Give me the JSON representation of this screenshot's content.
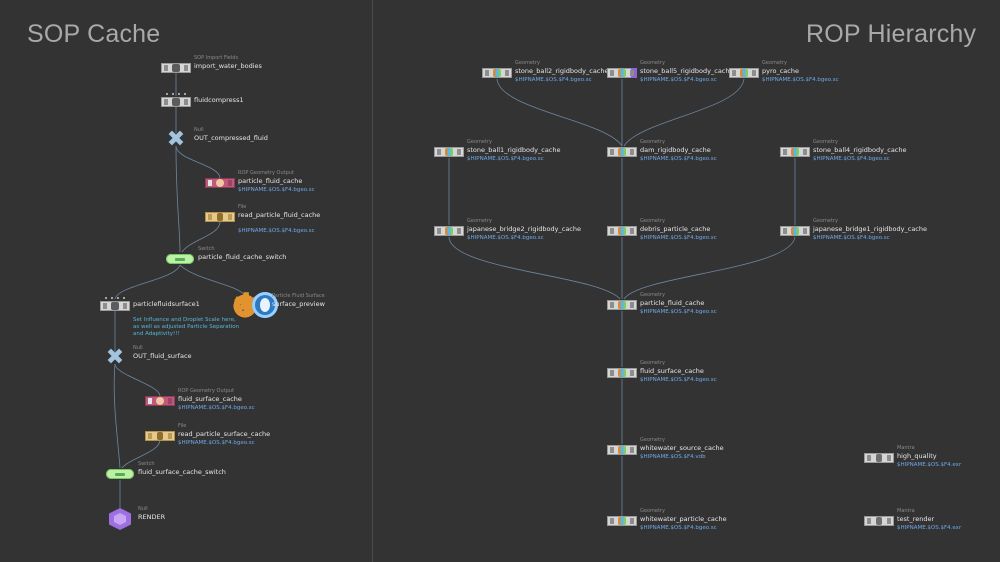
{
  "panels": {
    "left": {
      "title": "SOP Cache"
    },
    "right": {
      "title": "ROP Hierarchy"
    }
  },
  "sop_nodes": {
    "import_water_bodies": {
      "type": "SOP Import Fields",
      "name": "import_water_bodies",
      "icon": "sop-import-fields-icon"
    },
    "fluidcompress1": {
      "type": "",
      "name": "fluidcompress1",
      "icon": "fluid-compress-icon"
    },
    "out_compressed_fluid": {
      "type": "Null",
      "name": "OUT_compressed_fluid",
      "icon": "null-x-icon"
    },
    "particle_fluid_cache": {
      "type": "ROP Geometry Output",
      "name": "particle_fluid_cache",
      "path": "$HIPNAME.$OS.$F4.bgeo.sc",
      "icon": "rop-geometry-output-icon"
    },
    "read_particle_fluid_cache": {
      "type": "File",
      "name": "read_particle_fluid_cache",
      "path": "$HIPNAME.$OS.$F4.bgeo.sc",
      "icon": "file-icon"
    },
    "particle_fluid_cache_switch": {
      "type": "Switch",
      "name": "particle_fluid_cache_switch",
      "icon": "switch-icon"
    },
    "particlefluidsurface1": {
      "type": "",
      "name": "particlefluidsurface1",
      "comment": "Set Influence and Droplet Scale here, as well as adjusted Particle Separation and Adaptivity!!!",
      "icon": "particle-fluid-surface-icon"
    },
    "surface_preview": {
      "type": "Particle Fluid Surface",
      "name": "surface_preview",
      "icon": "particle-fluid-surface-gear-icon"
    },
    "out_fluid_surface": {
      "type": "Null",
      "name": "OUT_fluid_surface",
      "icon": "null-x-icon"
    },
    "fluid_surface_cache": {
      "type": "ROP Geometry Output",
      "name": "fluid_surface_cache",
      "path": "$HIPNAME.$OS.$F4.bgeo.sc",
      "icon": "rop-geometry-output-icon"
    },
    "read_particle_surface_cache": {
      "type": "File",
      "name": "read_particle_surface_cache",
      "path": "$HIPNAME.$OS.$F4.bgeo.sc",
      "icon": "file-icon"
    },
    "fluid_surface_cache_switch": {
      "type": "Switch",
      "name": "fluid_surface_cache_switch",
      "icon": "switch-icon"
    },
    "render": {
      "type": "Null",
      "name": "RENDER",
      "icon": "render-cube-icon"
    }
  },
  "rop_nodes": {
    "stone_ball2": {
      "type": "Geometry",
      "name": "stone_ball2_rigidbody_cache",
      "path": "$HIPNAME.$OS.$F4.bgeo.sc"
    },
    "stone_ball5": {
      "type": "Geometry",
      "name": "stone_ball5_rigidbody_cache",
      "path": "$HIPNAME.$OS.$F4.bgeo.sc"
    },
    "pyro_cache": {
      "type": "Geometry",
      "name": "pyro_cache",
      "path": "$HIPNAME.$OS.$F4.bgeo.sc"
    },
    "stone_ball1": {
      "type": "Geometry",
      "name": "stone_ball1_rigidbody_cache",
      "path": "$HIPNAME.$OS.$F4.bgeo.sc"
    },
    "dam": {
      "type": "Geometry",
      "name": "dam_rigidbody_cache",
      "path": "$HIPNAME.$OS.$F4.bgeo.sc"
    },
    "stone_ball4": {
      "type": "Geometry",
      "name": "stone_ball4_rigidbody_cache",
      "path": "$HIPNAME.$OS.$F4.bgeo.sc"
    },
    "japanese_bridge2": {
      "type": "Geometry",
      "name": "japanese_bridge2_rigidbody_cache",
      "path": "$HIPNAME.$OS.$F4.bgeo.sc"
    },
    "debris": {
      "type": "Geometry",
      "name": "debris_particle_cache",
      "path": "$HIPNAME.$OS.$F4.bgeo.sc"
    },
    "japanese_bridge1": {
      "type": "Geometry",
      "name": "japanese_bridge1_rigidbody_cache",
      "path": "$HIPNAME.$OS.$F4.bgeo.sc"
    },
    "particle_fluid_cache": {
      "type": "Geometry",
      "name": "particle_fluid_cache",
      "path": "$HIPNAME.$OS.$F4.bgeo.sc"
    },
    "fluid_surface_cache": {
      "type": "Geometry",
      "name": "fluid_surface_cache",
      "path": "$HIPNAME.$OS.$F4.bgeo.sc"
    },
    "whitewater_source": {
      "type": "Geometry",
      "name": "whitewater_source_cache",
      "path": "$HIPNAME.$OS.$F4.vdb"
    },
    "whitewater_particle": {
      "type": "Geometry",
      "name": "whitewater_particle_cache",
      "path": "$HIPNAME.$OS.$F4.bgeo.sc"
    },
    "high_quality": {
      "type": "Mantra",
      "name": "high_quality",
      "path": "$HIPNAME.$OS.$F4.exr"
    },
    "test_render": {
      "type": "Mantra",
      "name": "test_render",
      "path": "$HIPNAME.$OS.$F4.exr"
    }
  },
  "colors": {
    "background": "#333333",
    "wire": "#6f86a0",
    "path_text": "#6fa8e8",
    "comment_text": "#54b8d8"
  }
}
